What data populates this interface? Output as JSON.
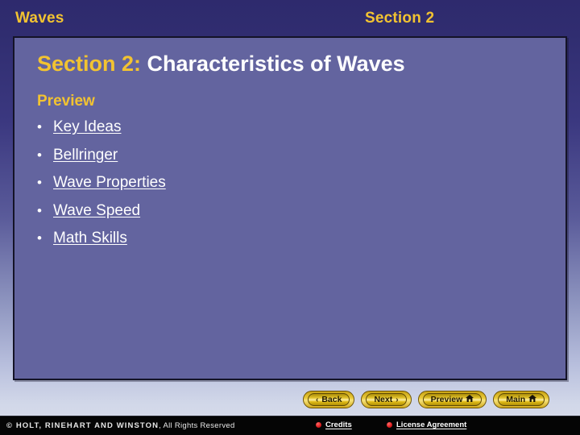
{
  "header": {
    "left_title": "Waves",
    "right_title": "Section 2",
    "accent_color": "#f2c331"
  },
  "slide": {
    "title_accent": "Section 2:",
    "title_plain": " Characteristics of Waves",
    "preview_heading": "Preview",
    "bullet_glyph": "•",
    "links": [
      {
        "label": "Key Ideas"
      },
      {
        "label": "Bellringer"
      },
      {
        "label": "Wave Properties"
      },
      {
        "label": "Wave Speed"
      },
      {
        "label": "Math Skills"
      }
    ],
    "panel_color": "#63649f",
    "text_color": "#ffffff"
  },
  "nav": {
    "buttons": [
      {
        "label": "Back",
        "left_icon": "‹",
        "right_icon": ""
      },
      {
        "label": "Next",
        "left_icon": "",
        "right_icon": "›"
      },
      {
        "label": "Preview",
        "left_icon": "",
        "right_icon": "⌂"
      },
      {
        "label": "Main",
        "left_icon": "",
        "right_icon": "⌂"
      }
    ]
  },
  "footer": {
    "copyright_strong": "© HOLT, RINEHART AND WINSTON",
    "copyright_rest": ", All Rights Reserved",
    "credits_label": "Credits",
    "license_label": "License Agreement",
    "dot_color": "#e02020"
  }
}
